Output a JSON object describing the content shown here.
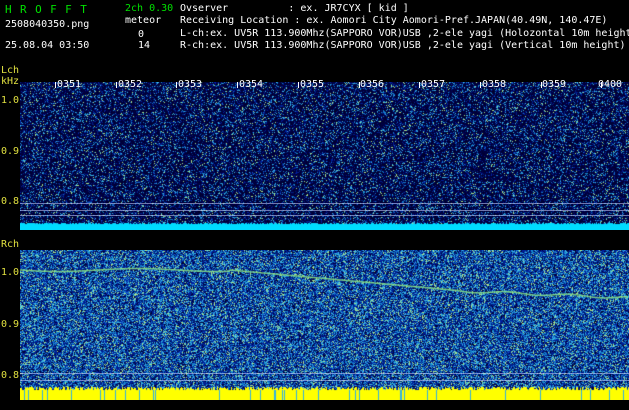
{
  "header": {
    "app_title": "H R O F F T",
    "mode": "2ch 0.30",
    "meteor_label": "meteor",
    "filename": "2508040350.png",
    "datetime": "25.08.04 03:50",
    "meteor_l": "0",
    "meteor_r": "14",
    "observer": "Ovserver          : ex. JR7CYX [ kid ]",
    "location": "Receiving Location : ex. Aomori City Aomori-Pref.JAPAN(40.49N, 140.47E)",
    "lch_info": "L-ch:ex. UV5R 113.900Mhz(SAPPORO VOR)USB ,2-ele yagi (Holozontal 10m height)",
    "rch_info": "R-ch:ex. UV5R 113.900Mhz(SAPPORO VOR)USB ,2-ele yagi (Vertical 10m height)"
  },
  "axis": {
    "lch_label": "Lch",
    "unit_label": "kHz",
    "rch_label": "Rch",
    "time_ticks": [
      "0351",
      "0352",
      "0353",
      "0354",
      "0355",
      "0356",
      "0357",
      "0358",
      "0359",
      "0400"
    ],
    "lch_y_ticks": [
      "1.0",
      "0.9",
      "0.8"
    ],
    "rch_y_ticks": [
      "1.0",
      "0.9",
      "0.8"
    ]
  },
  "colors": {
    "header_green": "#00e000",
    "axis_yellow": "#e0e040",
    "band_cyan": "#00e0ff",
    "band_yellow": "#ffff00",
    "background": "#000000"
  }
}
